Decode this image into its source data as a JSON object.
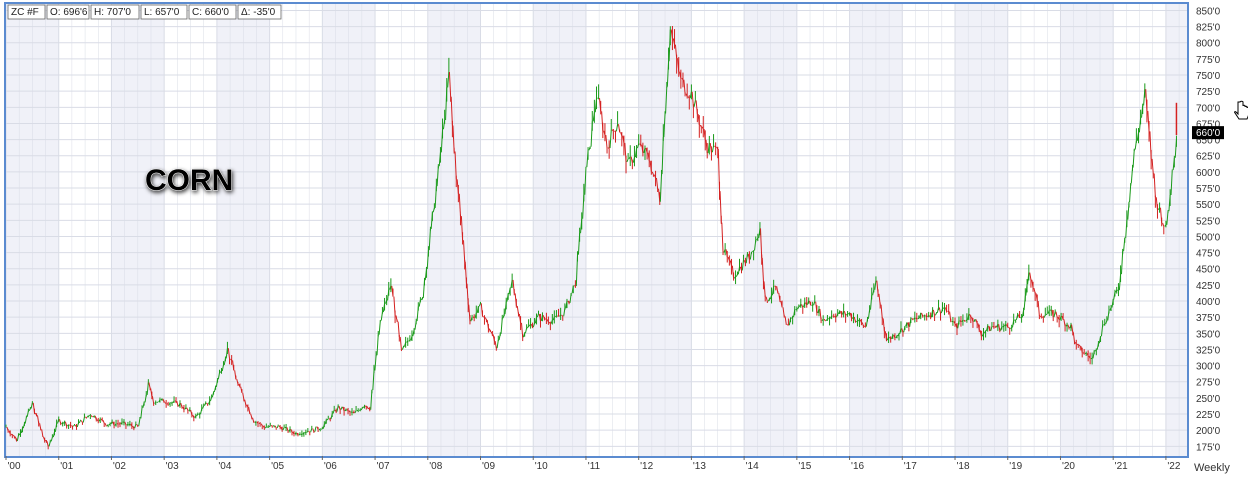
{
  "header": {
    "symbol": "ZC #F",
    "open": "O: 696'6",
    "high": "H: 707'0",
    "low": "L: 657'0",
    "close": "C: 660'0",
    "change": "Δ: -35'0"
  },
  "annotation_label": "CORN",
  "timeframe_label": "Weekly",
  "last_price_label": "660'0",
  "colors": {
    "up": "#1a9a1a",
    "down": "#d42020",
    "frame": "#5b8bd0",
    "grid": "#d9dce6",
    "stripe": "#f0f1f8",
    "price_tag_bg": "#000000",
    "price_tag_text": "#ffffff"
  },
  "chart_data": {
    "type": "line",
    "title": "",
    "xlabel": "",
    "ylabel": "",
    "x_ticks": [
      "'00",
      "'01",
      "'02",
      "'03",
      "'04",
      "'05",
      "'06",
      "'07",
      "'08",
      "'09",
      "'10",
      "'11",
      "'12",
      "'13",
      "'14",
      "'15",
      "'16",
      "'17",
      "'18",
      "'19",
      "'20",
      "'21",
      "'22"
    ],
    "y_ticks": [
      "175'0",
      "200'0",
      "225'0",
      "250'0",
      "275'0",
      "300'0",
      "325'0",
      "350'0",
      "375'0",
      "400'0",
      "425'0",
      "450'0",
      "475'0",
      "500'0",
      "525'0",
      "550'0",
      "575'0",
      "600'0",
      "625'0",
      "650'0",
      "675'0",
      "700'0",
      "725'0",
      "750'0",
      "775'0",
      "800'0",
      "825'0",
      "850'0"
    ],
    "y_tick_values": [
      175,
      200,
      225,
      250,
      275,
      300,
      325,
      350,
      375,
      400,
      425,
      450,
      475,
      500,
      525,
      550,
      575,
      600,
      625,
      650,
      675,
      700,
      725,
      750,
      775,
      800,
      825,
      850
    ],
    "ylim": [
      160,
      860
    ],
    "xlim": [
      2000.0,
      2022.4
    ],
    "grid": true,
    "series": [
      {
        "x": [
          2000.0,
          2000.2,
          2000.5,
          2000.7,
          2000.8,
          2001.0,
          2001.3,
          2001.6,
          2001.9,
          2002.2,
          2002.5,
          2002.7,
          2002.8,
          2003.0,
          2003.3,
          2003.6,
          2003.9,
          2004.2,
          2004.4,
          2004.7,
          2004.9,
          2005.2,
          2005.5,
          2005.8,
          2006.0,
          2006.3,
          2006.6,
          2006.8,
          2006.9,
          2007.1,
          2007.3,
          2007.5,
          2007.7,
          2007.9,
          2008.2,
          2008.4,
          2008.5,
          2008.7,
          2008.8,
          2009.0,
          2009.3,
          2009.6,
          2009.8,
          2010.1,
          2010.4,
          2010.6,
          2010.8,
          2011.0,
          2011.2,
          2011.4,
          2011.6,
          2011.8,
          2012.0,
          2012.2,
          2012.4,
          2012.5,
          2012.6,
          2012.8,
          2013.0,
          2013.3,
          2013.5,
          2013.6,
          2013.8,
          2014.1,
          2014.3,
          2014.4,
          2014.6,
          2014.8,
          2015.0,
          2015.3,
          2015.5,
          2015.7,
          2016.0,
          2016.3,
          2016.5,
          2016.7,
          2016.9,
          2017.2,
          2017.5,
          2017.8,
          2018.0,
          2018.3,
          2018.5,
          2018.7,
          2019.0,
          2019.3,
          2019.4,
          2019.6,
          2019.9,
          2020.2,
          2020.3,
          2020.6,
          2020.8,
          2021.0,
          2021.1,
          2021.3,
          2021.4,
          2021.6,
          2021.8,
          2022.0,
          2022.2
        ],
        "y": [
          205,
          185,
          240,
          190,
          175,
          215,
          205,
          225,
          210,
          210,
          205,
          270,
          245,
          245,
          240,
          220,
          250,
          325,
          270,
          215,
          205,
          205,
          195,
          200,
          205,
          235,
          225,
          240,
          235,
          370,
          425,
          320,
          350,
          410,
          600,
          750,
          630,
          460,
          370,
          390,
          330,
          430,
          350,
          375,
          370,
          385,
          430,
          600,
          720,
          640,
          680,
          610,
          640,
          620,
          560,
          700,
          820,
          740,
          720,
          640,
          630,
          480,
          440,
          470,
          510,
          400,
          420,
          360,
          390,
          400,
          370,
          380,
          380,
          360,
          430,
          340,
          350,
          370,
          380,
          390,
          360,
          380,
          350,
          360,
          360,
          380,
          450,
          380,
          380,
          360,
          330,
          310,
          360,
          400,
          420,
          560,
          630,
          720,
          560,
          510,
          660
        ]
      }
    ]
  }
}
